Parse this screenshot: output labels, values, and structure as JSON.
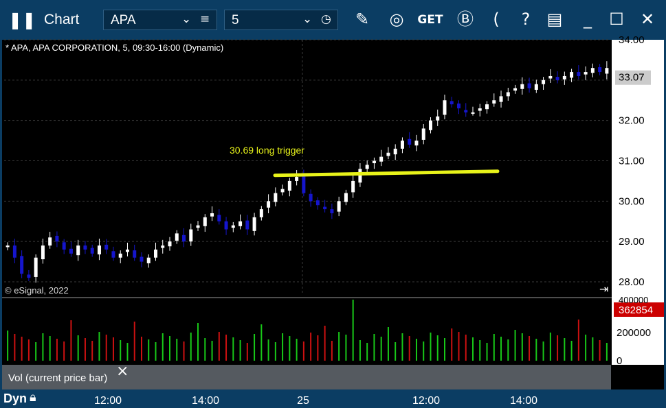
{
  "window": {
    "title": "Chart",
    "symbol_value": "APA",
    "interval_value": "5",
    "get_label": "GET",
    "buttons": [
      "pencil",
      "line-study",
      "get",
      "b",
      "c",
      "help",
      "template",
      "minimize",
      "maximize",
      "close"
    ]
  },
  "chart": {
    "header": "* APA, APA CORPORATION, 5, 09:30-16:00 (Dynamic)",
    "copyright": "© eSignal, 2022",
    "annotation": "30.69 long trigger",
    "price_ticks": [
      "34.00",
      "33.07",
      "32.00",
      "31.00",
      "30.00",
      "29.00",
      "28.00"
    ],
    "last_price": "33.07",
    "volume_last": "362854",
    "volume_ticks": [
      "200000",
      "0"
    ],
    "volume_partial": "400000",
    "vol_legend": "Vol (current price bar)",
    "close_symbol": "×",
    "time_ticks": [
      "12:00",
      "14:00",
      "25",
      "12:00",
      "14:00"
    ],
    "mode_label": "Dyn",
    "colors": {
      "up": "#ffffff",
      "down": "#1515cc",
      "trigger": "#e8f31a",
      "vol_up": "#18c818",
      "vol_down": "#cc1111",
      "last_price_bg": "#cccccc",
      "volume_last_bg": "#cc0000"
    }
  },
  "chart_data": {
    "type": "candlestick",
    "title": "* APA, APA CORPORATION, 5, 09:30-16:00 (Dynamic)",
    "ylim": [
      28.0,
      34.0
    ],
    "trigger_level": 30.69,
    "last_price": 33.07,
    "last_volume": 362854,
    "price_path": [
      28.9,
      28.6,
      28.2,
      28.1,
      28.6,
      28.9,
      29.1,
      29.0,
      28.8,
      28.7,
      28.9,
      28.8,
      28.7,
      28.9,
      28.8,
      28.6,
      28.7,
      28.8,
      28.6,
      28.5,
      28.6,
      28.8,
      28.9,
      29.0,
      29.2,
      29.0,
      29.3,
      29.4,
      29.6,
      29.7,
      29.5,
      29.3,
      29.4,
      29.5,
      29.3,
      29.6,
      29.8,
      30.0,
      30.2,
      30.3,
      30.5,
      30.6,
      30.2,
      30.0,
      29.9,
      29.8,
      29.7,
      30.0,
      30.2,
      30.5,
      30.8,
      30.9,
      31.0,
      31.1,
      31.2,
      31.3,
      31.5,
      31.4,
      31.5,
      31.8,
      32.0,
      32.1,
      32.5,
      32.4,
      32.3,
      32.2,
      32.2,
      32.3,
      32.4,
      32.5,
      32.6,
      32.7,
      32.8,
      32.9,
      32.8,
      32.9,
      33.0,
      33.1,
      33.0,
      33.1,
      33.2,
      33.1,
      33.2,
      33.3,
      33.2,
      33.3
    ],
    "volume_ticks": [
      0,
      200000
    ]
  }
}
